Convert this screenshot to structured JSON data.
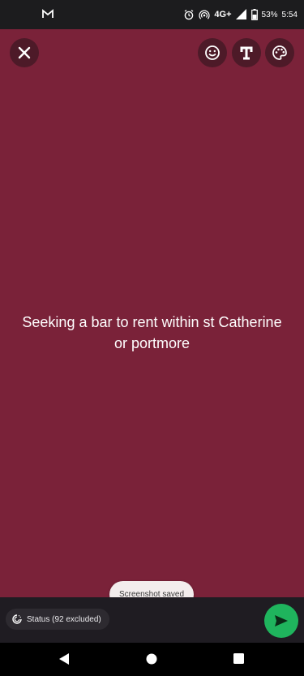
{
  "status_bar": {
    "network": "4G+",
    "battery": "53%",
    "time": "5:54"
  },
  "canvas": {
    "background_color": "#7a2239",
    "text": "Seeking a bar to rent within st Catherine or portmore"
  },
  "toolbar": {
    "close_icon": "close-icon",
    "emoji_icon": "emoji-icon",
    "text_icon": "text-icon",
    "palette_icon": "palette-icon"
  },
  "toast": {
    "message": "Screenshot saved"
  },
  "bottom": {
    "audience_label": "Status (92 excluded)",
    "send_color": "#1fb45d"
  }
}
